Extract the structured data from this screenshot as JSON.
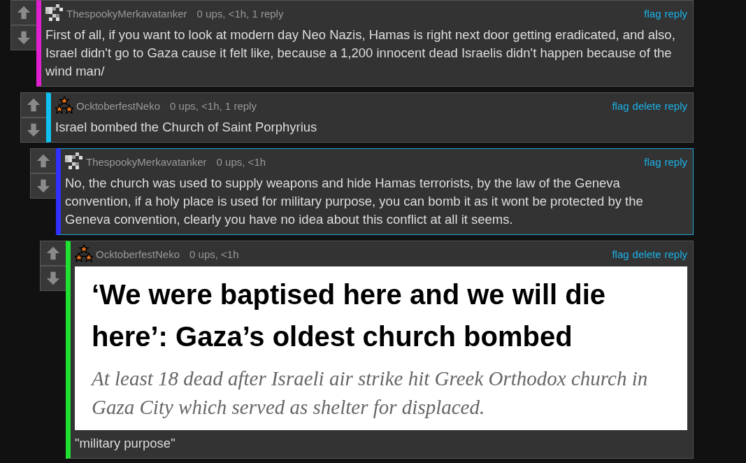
{
  "comments": [
    {
      "author": "ThespookyMerkavatanker",
      "avatar": {
        "kind": "checker"
      },
      "meta": "0 ups, <1h, 1 reply",
      "actions": [
        "flag",
        "reply"
      ],
      "color": "#e020d0",
      "highlighted": false,
      "text": "First of all, if you want to look at modern day Neo Nazis, Hamas is right next door getting eradicated, and also, Israel didn't go to Gaza cause it felt like, because a 1,200 innocent dead Israelis didn't happen because of the wind man/",
      "children": [
        {
          "author": "OcktoberfestNeko",
          "avatar": {
            "kind": "stars"
          },
          "meta": "0 ups, <1h, 1 reply",
          "actions": [
            "flag",
            "delete",
            "reply"
          ],
          "color": "#10c0f0",
          "highlighted": false,
          "text": "Israel bombed the Church of Saint Porphyrius",
          "children": [
            {
              "author": "ThespookyMerkavatanker",
              "avatar": {
                "kind": "checker"
              },
              "meta": "0 ups, <1h",
              "actions": [
                "flag",
                "reply"
              ],
              "color": "#3030ff",
              "highlighted": true,
              "text": "No, the church was used to supply weapons and hide Hamas terrorists, by the law of the Geneva convention, if a holy place is used for military purpose, you can bomb it as it wont be protected by the Geneva convention, clearly you have no idea about this conflict at all it seems.",
              "children": [
                {
                  "author": "OcktoberfestNeko",
                  "avatar": {
                    "kind": "stars"
                  },
                  "meta": "0 ups, <1h",
                  "actions": [
                    "flag",
                    "delete",
                    "reply"
                  ],
                  "color": "#20e030",
                  "highlighted": false,
                  "attachment": {
                    "headline": "‘We were baptised here and we will die here’: Gaza’s oldest church bombed",
                    "subtitle": "At least 18 dead after Israeli air strike hit Greek Orthodox church in Gaza City which served as shelter for displaced."
                  },
                  "text": "\"military purpose\""
                }
              ]
            }
          ]
        }
      ]
    }
  ]
}
